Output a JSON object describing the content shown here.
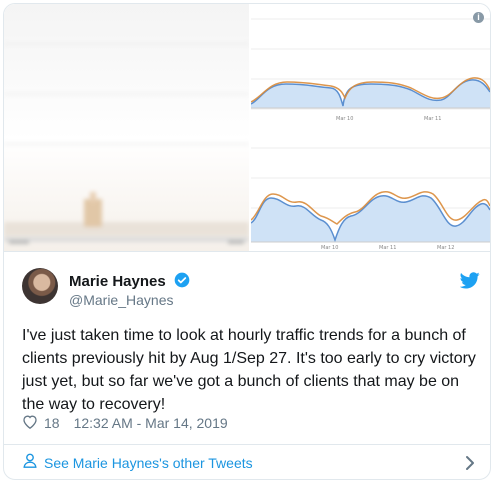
{
  "tweet": {
    "author_name": "Marie Haynes",
    "author_handle": "@Marie_Haynes",
    "text": "I've just taken time to look at hourly traffic trends for a bunch of clients previously hit by Aug 1/Sep 27. It's too early to cry victory just yet, but so far we've got a bunch of clients that may be on the way to recovery!",
    "like_count": "18",
    "timestamp": "12:32 AM - Mar 14, 2019"
  },
  "media": {
    "top_right_labels": [
      "Mar 10",
      "Mar 11"
    ],
    "bottom_right_labels": [
      "Mar 10",
      "Mar 11",
      "Mar 12"
    ]
  },
  "footer": {
    "other_tweets_label": "See Marie Haynes's other Tweets"
  },
  "icons": {
    "verified": "verified-badge-icon",
    "brand": "twitter-bird-icon",
    "like": "heart-icon",
    "info": "info-icon",
    "person": "person-icon",
    "chevron": "chevron-right-icon"
  },
  "colors": {
    "accent": "#1da1f2",
    "link": "#1b95e0",
    "secondary_text": "#657786",
    "border": "#e1e8ed",
    "chart_fill": "#c9dff5",
    "chart_line_blue": "#5b8fd0",
    "chart_line_orange": "#d98b3a"
  }
}
